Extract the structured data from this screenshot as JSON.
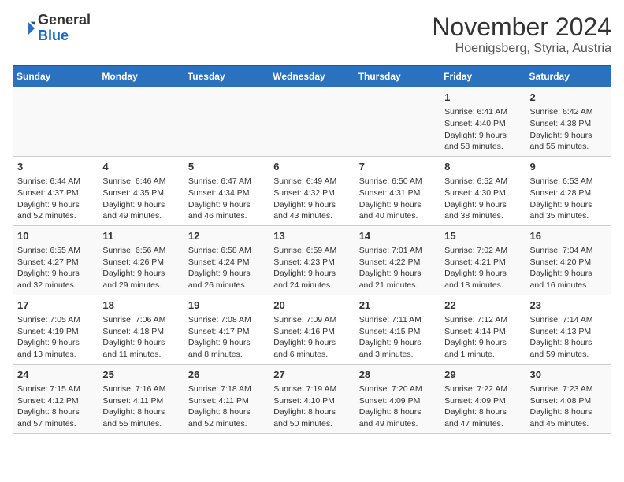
{
  "header": {
    "logo_line1": "General",
    "logo_line2": "Blue",
    "title": "November 2024",
    "subtitle": "Hoenigsberg, Styria, Austria"
  },
  "weekdays": [
    "Sunday",
    "Monday",
    "Tuesday",
    "Wednesday",
    "Thursday",
    "Friday",
    "Saturday"
  ],
  "weeks": [
    [
      {
        "day": "",
        "info": ""
      },
      {
        "day": "",
        "info": ""
      },
      {
        "day": "",
        "info": ""
      },
      {
        "day": "",
        "info": ""
      },
      {
        "day": "",
        "info": ""
      },
      {
        "day": "1",
        "info": "Sunrise: 6:41 AM\nSunset: 4:40 PM\nDaylight: 9 hours and 58 minutes."
      },
      {
        "day": "2",
        "info": "Sunrise: 6:42 AM\nSunset: 4:38 PM\nDaylight: 9 hours and 55 minutes."
      }
    ],
    [
      {
        "day": "3",
        "info": "Sunrise: 6:44 AM\nSunset: 4:37 PM\nDaylight: 9 hours and 52 minutes."
      },
      {
        "day": "4",
        "info": "Sunrise: 6:46 AM\nSunset: 4:35 PM\nDaylight: 9 hours and 49 minutes."
      },
      {
        "day": "5",
        "info": "Sunrise: 6:47 AM\nSunset: 4:34 PM\nDaylight: 9 hours and 46 minutes."
      },
      {
        "day": "6",
        "info": "Sunrise: 6:49 AM\nSunset: 4:32 PM\nDaylight: 9 hours and 43 minutes."
      },
      {
        "day": "7",
        "info": "Sunrise: 6:50 AM\nSunset: 4:31 PM\nDaylight: 9 hours and 40 minutes."
      },
      {
        "day": "8",
        "info": "Sunrise: 6:52 AM\nSunset: 4:30 PM\nDaylight: 9 hours and 38 minutes."
      },
      {
        "day": "9",
        "info": "Sunrise: 6:53 AM\nSunset: 4:28 PM\nDaylight: 9 hours and 35 minutes."
      }
    ],
    [
      {
        "day": "10",
        "info": "Sunrise: 6:55 AM\nSunset: 4:27 PM\nDaylight: 9 hours and 32 minutes."
      },
      {
        "day": "11",
        "info": "Sunrise: 6:56 AM\nSunset: 4:26 PM\nDaylight: 9 hours and 29 minutes."
      },
      {
        "day": "12",
        "info": "Sunrise: 6:58 AM\nSunset: 4:24 PM\nDaylight: 9 hours and 26 minutes."
      },
      {
        "day": "13",
        "info": "Sunrise: 6:59 AM\nSunset: 4:23 PM\nDaylight: 9 hours and 24 minutes."
      },
      {
        "day": "14",
        "info": "Sunrise: 7:01 AM\nSunset: 4:22 PM\nDaylight: 9 hours and 21 minutes."
      },
      {
        "day": "15",
        "info": "Sunrise: 7:02 AM\nSunset: 4:21 PM\nDaylight: 9 hours and 18 minutes."
      },
      {
        "day": "16",
        "info": "Sunrise: 7:04 AM\nSunset: 4:20 PM\nDaylight: 9 hours and 16 minutes."
      }
    ],
    [
      {
        "day": "17",
        "info": "Sunrise: 7:05 AM\nSunset: 4:19 PM\nDaylight: 9 hours and 13 minutes."
      },
      {
        "day": "18",
        "info": "Sunrise: 7:06 AM\nSunset: 4:18 PM\nDaylight: 9 hours and 11 minutes."
      },
      {
        "day": "19",
        "info": "Sunrise: 7:08 AM\nSunset: 4:17 PM\nDaylight: 9 hours and 8 minutes."
      },
      {
        "day": "20",
        "info": "Sunrise: 7:09 AM\nSunset: 4:16 PM\nDaylight: 9 hours and 6 minutes."
      },
      {
        "day": "21",
        "info": "Sunrise: 7:11 AM\nSunset: 4:15 PM\nDaylight: 9 hours and 3 minutes."
      },
      {
        "day": "22",
        "info": "Sunrise: 7:12 AM\nSunset: 4:14 PM\nDaylight: 9 hours and 1 minute."
      },
      {
        "day": "23",
        "info": "Sunrise: 7:14 AM\nSunset: 4:13 PM\nDaylight: 8 hours and 59 minutes."
      }
    ],
    [
      {
        "day": "24",
        "info": "Sunrise: 7:15 AM\nSunset: 4:12 PM\nDaylight: 8 hours and 57 minutes."
      },
      {
        "day": "25",
        "info": "Sunrise: 7:16 AM\nSunset: 4:11 PM\nDaylight: 8 hours and 55 minutes."
      },
      {
        "day": "26",
        "info": "Sunrise: 7:18 AM\nSunset: 4:11 PM\nDaylight: 8 hours and 52 minutes."
      },
      {
        "day": "27",
        "info": "Sunrise: 7:19 AM\nSunset: 4:10 PM\nDaylight: 8 hours and 50 minutes."
      },
      {
        "day": "28",
        "info": "Sunrise: 7:20 AM\nSunset: 4:09 PM\nDaylight: 8 hours and 49 minutes."
      },
      {
        "day": "29",
        "info": "Sunrise: 7:22 AM\nSunset: 4:09 PM\nDaylight: 8 hours and 47 minutes."
      },
      {
        "day": "30",
        "info": "Sunrise: 7:23 AM\nSunset: 4:08 PM\nDaylight: 8 hours and 45 minutes."
      }
    ]
  ]
}
